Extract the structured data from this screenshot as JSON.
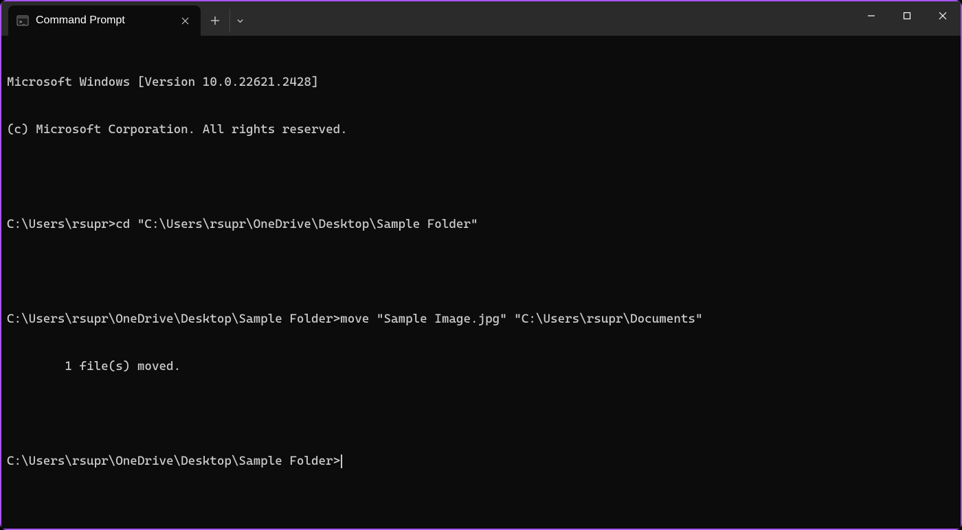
{
  "tab": {
    "title": "Command Prompt"
  },
  "terminal": {
    "lines": [
      "Microsoft Windows [Version 10.0.22621.2428]",
      "(c) Microsoft Corporation. All rights reserved.",
      "",
      "C:\\Users\\rsupr>cd \"C:\\Users\\rsupr\\OneDrive\\Desktop\\Sample Folder\"",
      "",
      "C:\\Users\\rsupr\\OneDrive\\Desktop\\Sample Folder>move \"Sample Image.jpg\" \"C:\\Users\\rsupr\\Documents\"",
      "        1 file(s) moved.",
      "",
      "C:\\Users\\rsupr\\OneDrive\\Desktop\\Sample Folder>"
    ]
  }
}
